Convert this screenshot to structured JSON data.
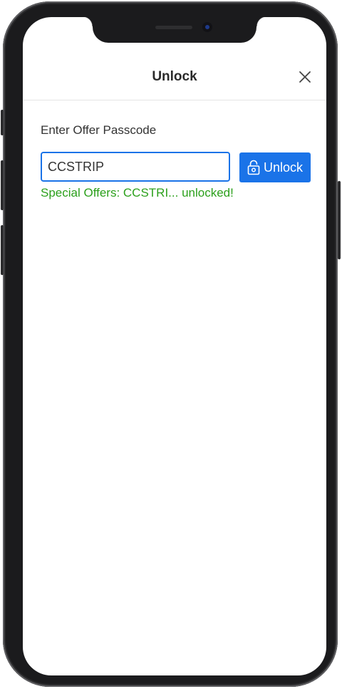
{
  "modal": {
    "title": "Unlock",
    "close_icon": "close-icon"
  },
  "form": {
    "label": "Enter Offer Passcode",
    "passcode_value": "CCSTRIP",
    "unlock_button_label": "Unlock",
    "unlock_button_icon": "lock-icon",
    "status_message": "Special Offers: CCSTRI... unlocked!"
  },
  "colors": {
    "accent": "#1a73e8",
    "success": "#2ca01c",
    "frame": "#1b1b1d"
  }
}
